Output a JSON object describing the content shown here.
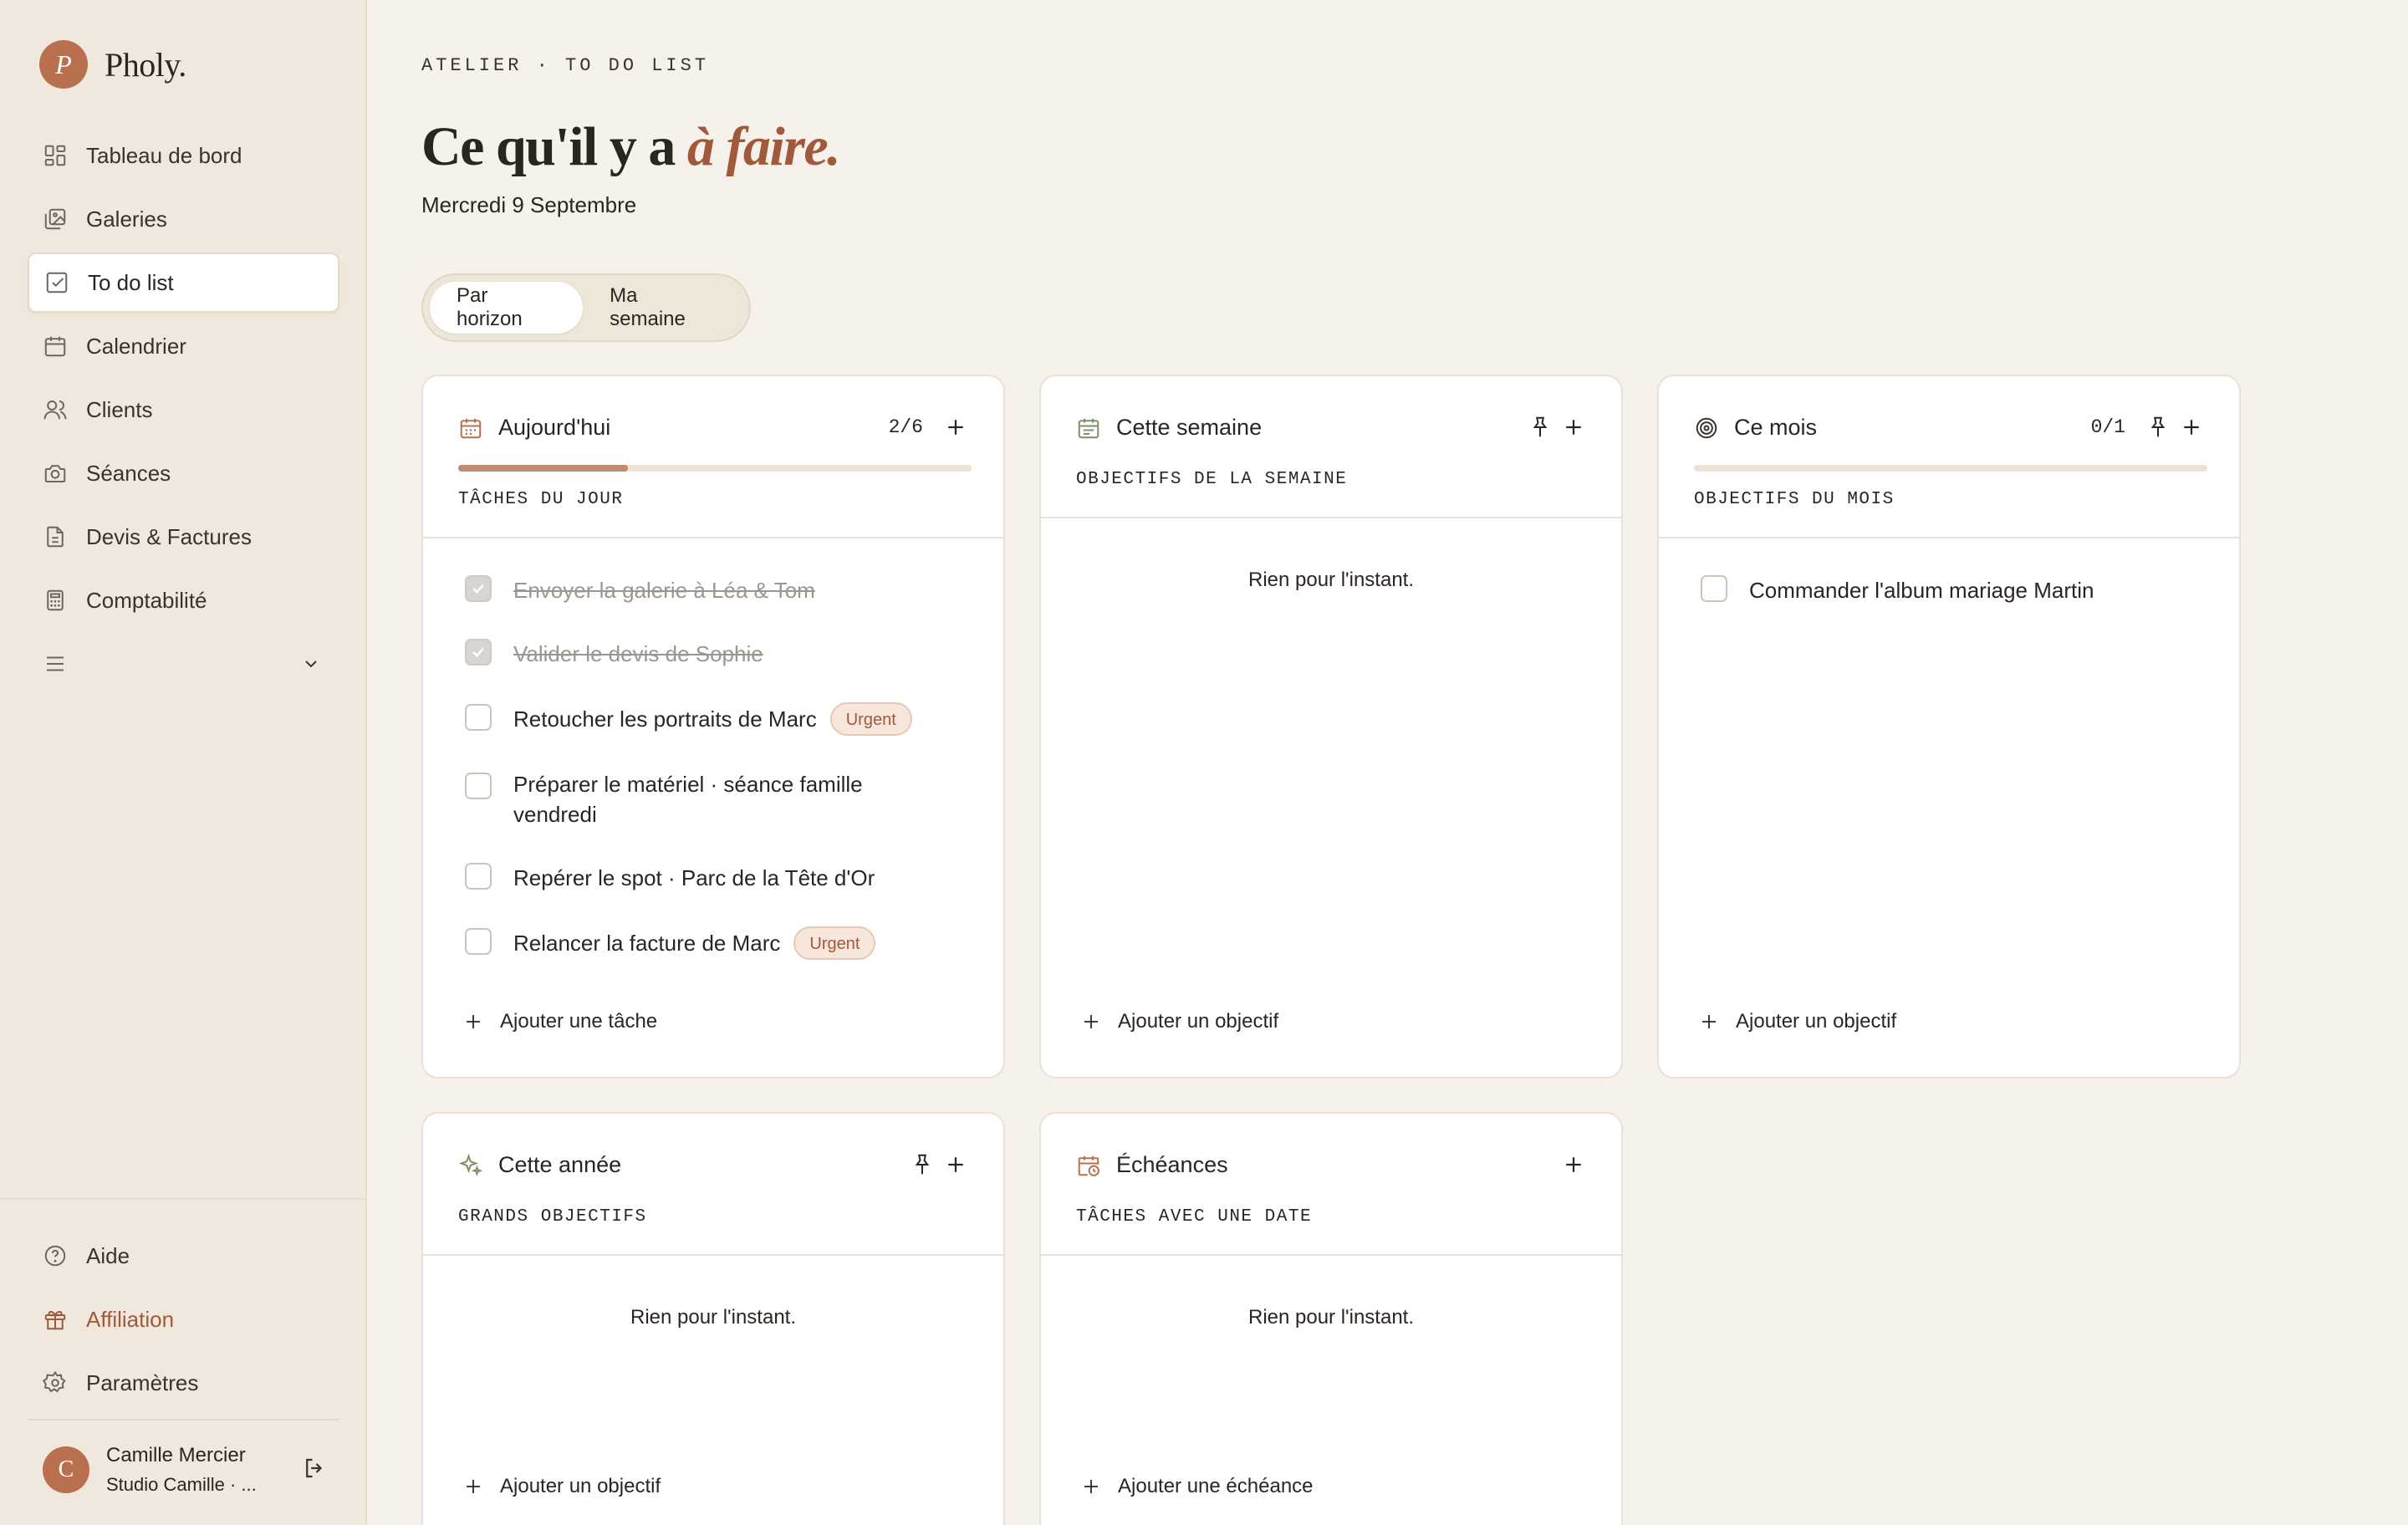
{
  "brand": {
    "initial": "P",
    "name": "Pholy."
  },
  "nav": {
    "items": [
      {
        "label": "Tableau de bord",
        "icon": "dashboard-icon"
      },
      {
        "label": "Galeries",
        "icon": "gallery-icon"
      },
      {
        "label": "To do list",
        "icon": "checklist-icon"
      },
      {
        "label": "Calendrier",
        "icon": "calendar-icon"
      },
      {
        "label": "Clients",
        "icon": "users-icon"
      },
      {
        "label": "Séances",
        "icon": "camera-icon"
      },
      {
        "label": "Devis & Factures",
        "icon": "document-icon"
      },
      {
        "label": "Comptabilité",
        "icon": "calculator-icon"
      }
    ],
    "active": "To do list"
  },
  "nav_bottom": {
    "help": "Aide",
    "affiliation": "Affiliation",
    "settings": "Paramètres"
  },
  "user": {
    "initial": "C",
    "name": "Camille Mercier",
    "studio": "Studio Camille · ..."
  },
  "header": {
    "eyebrow": "ATELIER · TO DO LIST",
    "title_plain": "Ce qu'il y a",
    "title_accent": "à faire.",
    "date": "Mercredi 9 Septembre"
  },
  "view_toggle": {
    "options": [
      "Par horizon",
      "Ma semaine"
    ],
    "selected": "Par horizon"
  },
  "cards": {
    "today": {
      "title": "Aujourd'hui",
      "count": "2/6",
      "progress": 0.33,
      "subtitle": "TÂCHES DU JOUR",
      "tasks": [
        {
          "text": "Envoyer la galerie à Léa & Tom",
          "done": true
        },
        {
          "text": "Valider le devis de Sophie",
          "done": true
        },
        {
          "text": "Retoucher les portraits de Marc",
          "done": false,
          "badge": "Urgent"
        },
        {
          "text": "Préparer le matériel · séance famille vendredi",
          "done": false
        },
        {
          "text": "Repérer le spot · Parc de la Tête d'Or",
          "done": false
        },
        {
          "text": "Relancer la facture de Marc",
          "done": false,
          "badge": "Urgent"
        }
      ],
      "add_label": "Ajouter une tâche"
    },
    "week": {
      "title": "Cette semaine",
      "subtitle": "OBJECTIFS DE LA SEMAINE",
      "empty": "Rien pour l'instant.",
      "add_label": "Ajouter un objectif"
    },
    "month": {
      "title": "Ce mois",
      "count": "0/1",
      "progress": 0,
      "subtitle": "OBJECTIFS DU MOIS",
      "tasks": [
        {
          "text": "Commander l'album mariage Martin",
          "done": false
        }
      ],
      "add_label": "Ajouter un objectif"
    },
    "year": {
      "title": "Cette année",
      "subtitle": "GRANDS OBJECTIFS",
      "empty": "Rien pour l'instant.",
      "add_label": "Ajouter un objectif"
    },
    "deadlines": {
      "title": "Échéances",
      "subtitle": "TÂCHES AVEC UNE DATE",
      "empty": "Rien pour l'instant.",
      "add_label": "Ajouter une échéance"
    }
  },
  "colors": {
    "accent": "#a05a3b",
    "brand": "#b9704f",
    "background": "#f6f1ea",
    "sidebar": "#f1e8dd",
    "progress": "#c08a6e"
  }
}
